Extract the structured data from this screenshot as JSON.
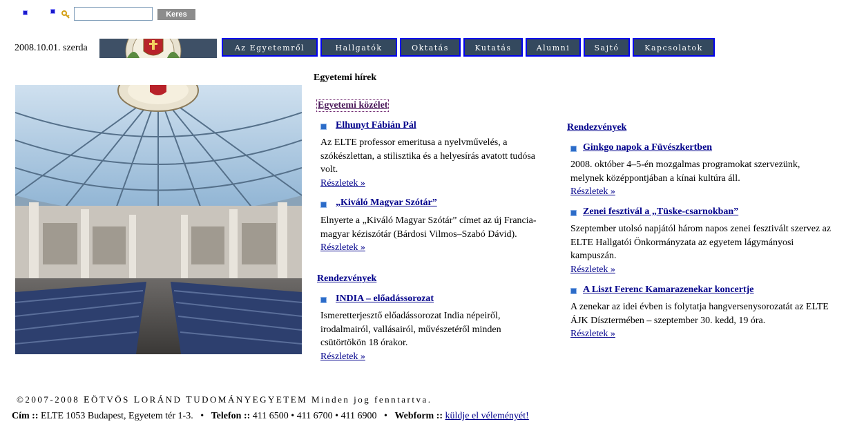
{
  "search": {
    "placeholder": "",
    "value": "",
    "button_label": "Keres"
  },
  "header": {
    "date": "2008.10.01. szerda"
  },
  "nav": [
    {
      "label": "Az Egyetemről"
    },
    {
      "label": "Hallgatók"
    },
    {
      "label": "Oktatás"
    },
    {
      "label": "Kutatás"
    },
    {
      "label": "Alumni"
    },
    {
      "label": "Sajtó"
    },
    {
      "label": "Kapcsolatok"
    }
  ],
  "news": {
    "heading": "Egyetemi hírek",
    "left": {
      "category1": "Egyetemi közélet",
      "item1": {
        "title": "Elhunyt Fábián Pál",
        "desc": [
          "Az ELTE professor emeritusa a nyelvművelés, a",
          "szókészlettan, a stilisztika és a helyesírás avatott tudósa",
          "volt."
        ],
        "more": "Részletek »"
      },
      "item2": {
        "title": "„Kiváló Magyar Szótár”",
        "desc": [
          "Elnyerte a „Kiváló Magyar Szótár” címet az új Francia-",
          "magyar kéziszótár (Bárdosi Vilmos–Szabó Dávid)."
        ],
        "more": "Részletek »"
      },
      "category2": "Rendezvények",
      "item3": {
        "title": "INDIA – előadássorozat",
        "desc": [
          "Ismeretterjesztő előadássorozat India népeiről,",
          "irodalmairól, vallásairól, művészetéről minden",
          "csütörtökön 18 órakor."
        ],
        "more": "Részletek »"
      }
    },
    "right": {
      "category": "Rendezvények",
      "item1": {
        "title": "Ginkgo napok a Füvészkertben",
        "desc": [
          "2008. október 4–5-én mozgalmas programokat szervezünk,",
          "melynek középpontjában a kínai kultúra áll."
        ],
        "more": "Részletek »"
      },
      "item2": {
        "title": "Zenei fesztivál a „Tüske-csarnokban”",
        "desc": [
          "Szeptember utolsó napjától három napos zenei fesztivált szervez az",
          "ELTE Hallgatói Önkormányzata az egyetem lágymányosi",
          "kampuszán."
        ],
        "more": "Részletek »"
      },
      "item3": {
        "title": "A Liszt Ferenc Kamarazenekar koncertje",
        "desc": [
          "A zenekar az idei évben is folytatja hangversenysorozatát az ELTE",
          "ÁJK Dísztermében – szeptember 30. kedd, 19 óra."
        ],
        "more": "Részletek »"
      }
    }
  },
  "footer": {
    "copyright_prefix": "©2007-2008",
    "university": [
      "E",
      "ÖTVÖS",
      "L",
      "ORÁND",
      "T",
      "UDOMÁNYEGYETEM"
    ],
    "rights": "Minden jog fenntartva.",
    "address_label": "Cím ::",
    "address": "ELTE 1053 Budapest, Egyetem tér 1-3.",
    "phone_label": "Telefon ::",
    "phone": "411 6500 • 411 6700 • 411 6900",
    "webform_label": "Webform ::",
    "webform_link": "küldje el véleményét!"
  }
}
